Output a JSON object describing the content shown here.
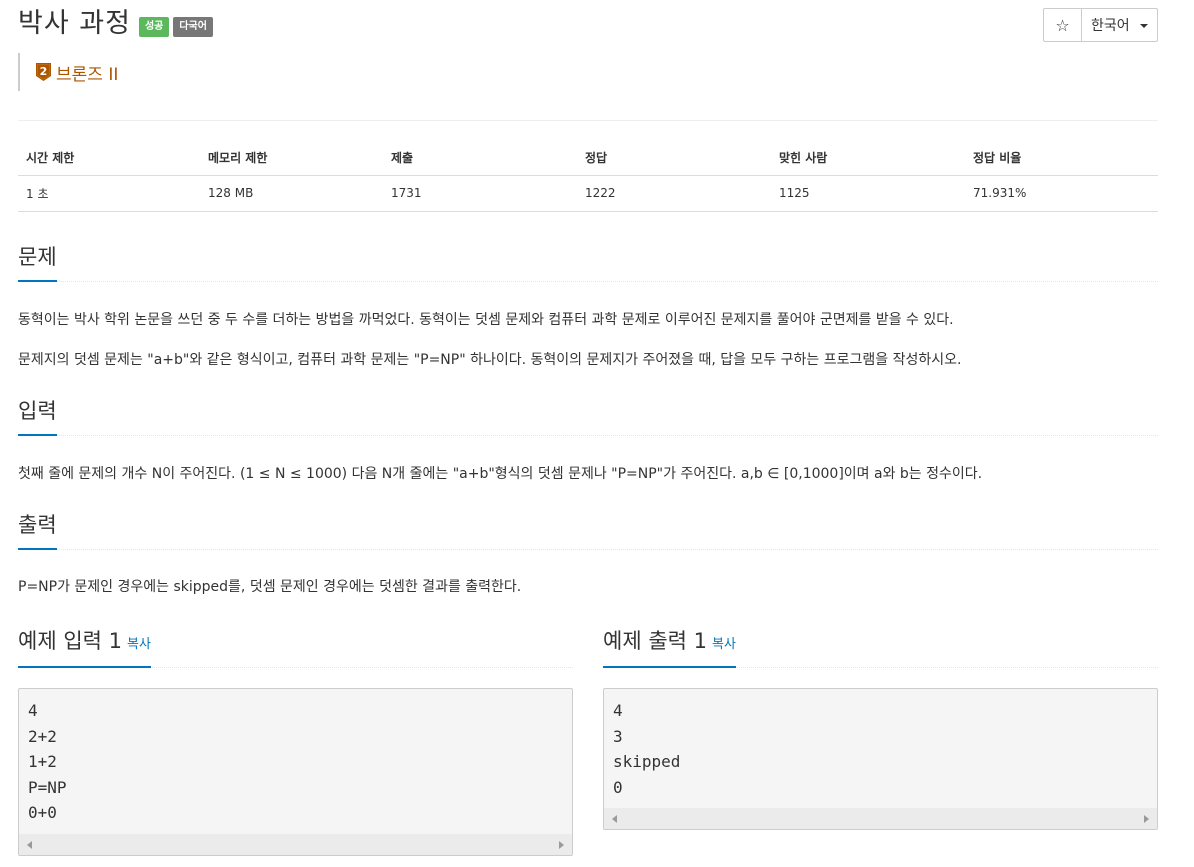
{
  "problem": {
    "title": "박사 과정",
    "label_success": "성공",
    "label_multilang": "다국어",
    "tier": "브론즈 II",
    "tier_icon": "bronze-2-badge-icon",
    "tier_color": "#ad5600"
  },
  "toolbar": {
    "star_symbol": "☆",
    "language": "한국어"
  },
  "info_table": {
    "headers": [
      "시간 제한",
      "메모리 제한",
      "제출",
      "정답",
      "맞힌 사람",
      "정답 비율"
    ],
    "row": [
      "1 초",
      "128 MB",
      "1731",
      "1222",
      "1125",
      "71.931%"
    ]
  },
  "sections": {
    "description": {
      "title": "문제",
      "p1": "동혁이는 박사 학위 논문을 쓰던 중 두 수를 더하는 방법을 까먹었다. 동혁이는 덧셈 문제와 컴퓨터 과학 문제로 이루어진 문제지를 풀어야 군면제를 받을 수 있다.",
      "p2": "문제지의 덧셈 문제는 \"a+b\"와 같은 형식이고, 컴퓨터 과학 문제는 \"P=NP\" 하나이다. 동혁이의 문제지가 주어졌을 때, 답을 모두 구하는 프로그램을 작성하시오."
    },
    "input": {
      "title": "입력",
      "p1": "첫째 줄에 문제의 개수 N이 주어진다. (1 ≤ N ≤ 1000) 다음 N개 줄에는 \"a+b\"형식의 덧셈 문제나 \"P=NP\"가 주어진다. a,b ∈ [0,1000]이며 a와 b는 정수이다."
    },
    "output": {
      "title": "출력",
      "p1": "P=NP가 문제인 경우에는 skipped를, 덧셈 문제인 경우에는 덧셈한 결과를 출력한다."
    }
  },
  "samples": {
    "input_title": "예제 입력 1",
    "output_title": "예제 출력 1",
    "copy_label": "복사",
    "input_lines": [
      "4",
      "2+2",
      "1+2",
      "P=NP",
      "0+0"
    ],
    "output_lines": [
      "4",
      "3",
      "skipped",
      "0"
    ]
  },
  "colors": {
    "accent": "#0076c0",
    "success": "#5cb85c",
    "default_label": "#777777"
  }
}
